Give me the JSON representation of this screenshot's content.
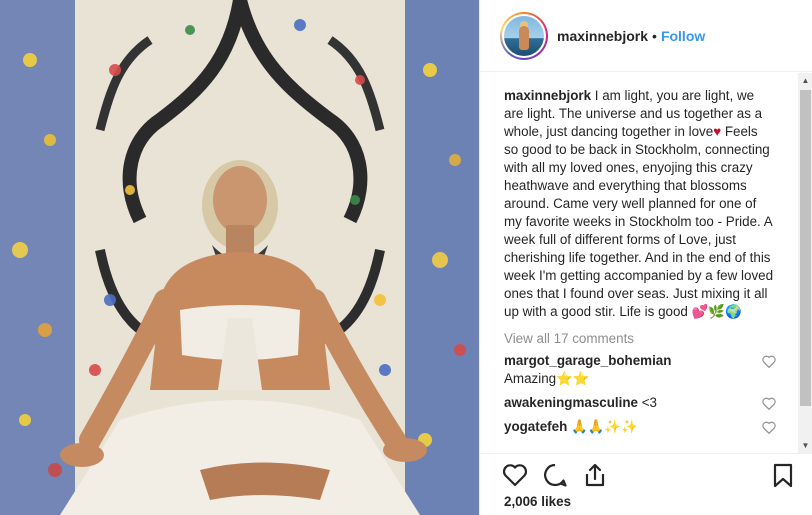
{
  "post": {
    "username": "maxinnebjork",
    "separator": "•",
    "follow_label": "Follow",
    "caption_user": "maxinnebjork",
    "caption_part1": " I am light, you are light, we are light. The universe and us together as a whole, just dancing together in love",
    "caption_heart": "♥",
    "caption_part2": " Feels so good to be back in Stockholm, connecting with all my loved ones, enyojing this crazy heathwave and everything that blossoms around. Came very well planned for one of my favorite weeks in Stockholm too - Pride. A week full of different forms of Love, just cherishing life together. And in the end of this week I'm getting accompanied by a few loved ones that I found over seas. Just mixing it all up with a good stir. Life is good ",
    "caption_tail": "💕🌿🌍",
    "view_all_comments": "View all 17 comments",
    "likes": "2,006 likes"
  },
  "comments": [
    {
      "user": "margot_garage_bohemian",
      "text": " Amazing⭐⭐"
    },
    {
      "user": "awakeningmasculine",
      "text": " <3"
    },
    {
      "user": "yogatefeh",
      "text": " 🙏🙏✨✨"
    }
  ],
  "icons": {
    "avatar": "profile-avatar",
    "like": "heart-outline-icon",
    "comment": "comment-bubble-icon",
    "share": "share-upload-icon",
    "save": "bookmark-icon"
  },
  "colors": {
    "link": "#3897f0",
    "text": "#262626",
    "muted": "#8e8e8e",
    "border": "#efefef"
  }
}
